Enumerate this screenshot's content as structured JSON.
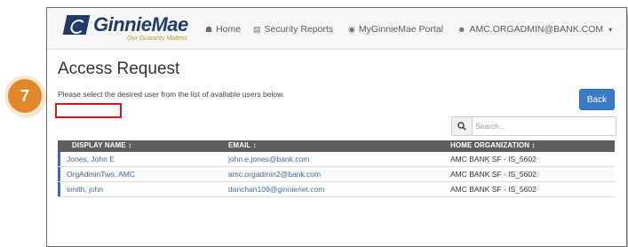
{
  "brand": {
    "name": "GinnieMae",
    "tagline": "Our Guaranty Matters"
  },
  "nav": {
    "home": "Home",
    "security_reports": "Security Reports",
    "portal": "MyGinnieMae Portal",
    "user": "AMC.ORGADMIN@BANK.COM"
  },
  "page": {
    "title": "Access Request",
    "instructions": "Please select the desired user from the list of available users below.",
    "back_label": "Back"
  },
  "search": {
    "placeholder": "Search..."
  },
  "table": {
    "headers": [
      "DISPLAY NAME ↕",
      "EMAIL ↕",
      "HOME ORGANIZATION ↕"
    ],
    "rows": [
      {
        "name": "Jones, John E",
        "email": "john.e.jones@bank.com",
        "org": "AMC BANK SF - IS_5602"
      },
      {
        "name": "OrgAdminTwo, AMC",
        "email": "amc.orgadmin2@bank.com",
        "org": "AMC BANK SF - IS_5602"
      },
      {
        "name": "smith, john",
        "email": "danchan109@ginnienet.com",
        "org": "AMC BANK SF - IS_5602"
      }
    ]
  },
  "annotation": {
    "step": "7",
    "highlight_color": "#d11a1a",
    "badge_color": "#e1892a"
  },
  "colors": {
    "brand_navy": "#1f3b68",
    "button_blue": "#3a7bc3",
    "link_blue": "#3b6ea5",
    "header_gray": "#5e5e5e"
  },
  "icons": {
    "home": "home-icon",
    "reports": "bar-chart-icon",
    "portal": "globe-icon",
    "user": "user-icon",
    "search": "search-icon",
    "user_menu": "caret-down-icon"
  }
}
